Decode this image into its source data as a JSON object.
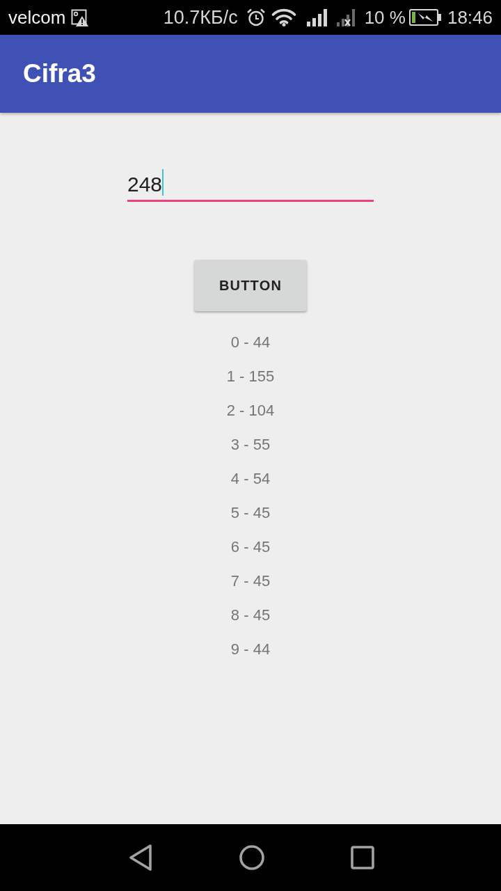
{
  "status_bar": {
    "carrier": "velcom",
    "network_speed": "10.7КБ/с",
    "battery_percent": "10 %",
    "time": "18:46"
  },
  "app_bar": {
    "title": "Cifra3"
  },
  "number_field": {
    "value": "248",
    "focused": true
  },
  "button": {
    "label": "BUTTON"
  },
  "results": [
    "0 - 44",
    "1 - 155",
    "2 - 104",
    "3 - 55",
    "4 - 54",
    "5 - 45",
    "6 - 45",
    "7 - 45",
    "8 - 45",
    "9 - 44"
  ]
}
